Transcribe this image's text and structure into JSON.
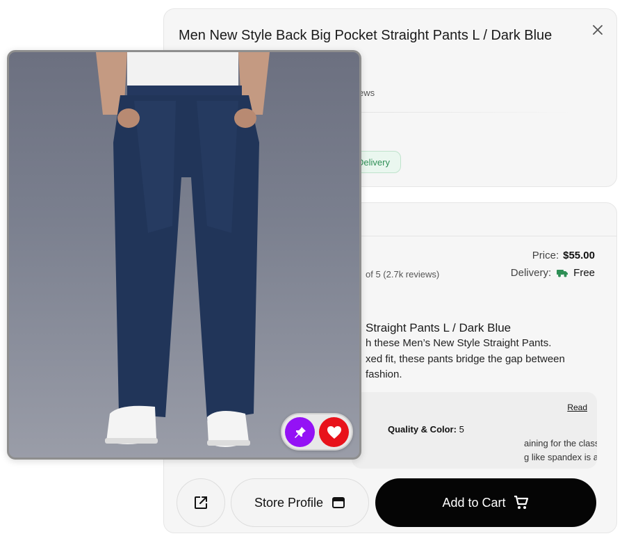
{
  "product": {
    "title": "Men New Style Back Big Pocket Straight Pants L / Dark Blue",
    "reviews_fragment": "ews",
    "delivery_chip": "Delivery"
  },
  "details": {
    "price_label": "Price:",
    "price_value": "$55.00",
    "delivery_label": "Delivery:",
    "delivery_value": "Free",
    "rating_fragment": "of 5 (2.7k reviews)",
    "name_fragment": "Straight Pants L / Dark Blue",
    "description_lines": [
      "h these Men’s New Style Straight Pants.",
      "xed fit, these pants bridge the gap between",
      "fashion."
    ]
  },
  "review": {
    "read_label": "Read",
    "quality_label": "Quality & Color:",
    "quality_value": "5",
    "text_lines": [
      "aining for the classic physique stage, finding pants",
      "g like spandex is a struggle. These Dark Blue Straight"
    ]
  },
  "actions": {
    "store_profile_label": "Store Profile",
    "add_to_cart_label": "Add to Cart"
  },
  "icons": {
    "close": "close-icon",
    "share": "external-link-icon",
    "store": "store-icon",
    "cart": "cart-icon",
    "truck": "truck-icon",
    "pin": "pin-icon",
    "heart": "heart-icon"
  },
  "colors": {
    "pin_button": "#9412f5",
    "favorite_button": "#e8121b",
    "cart_button": "#050505",
    "delivery_green": "#2f8f56"
  }
}
